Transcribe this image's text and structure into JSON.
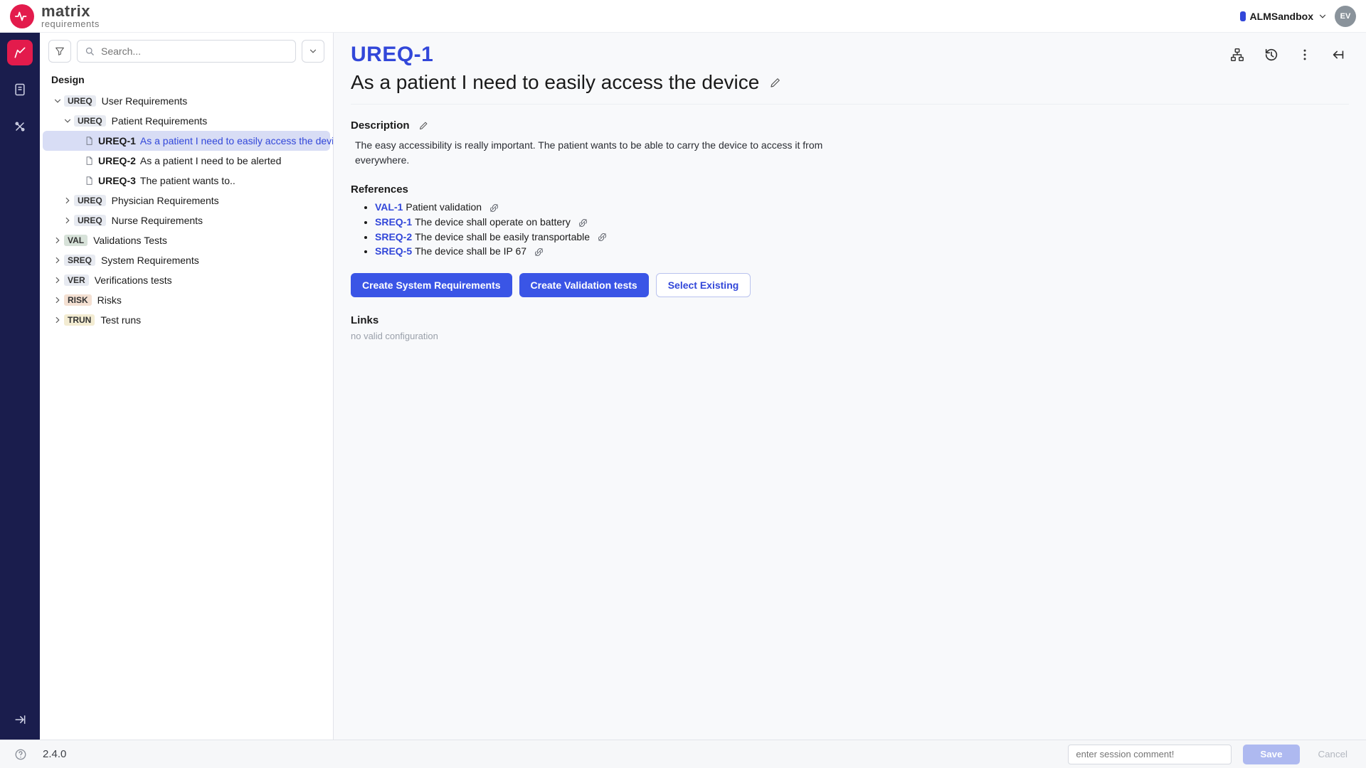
{
  "brand": {
    "line1": "matrix",
    "line2": "requirements"
  },
  "project": {
    "name": "ALMSandbox"
  },
  "avatar": "EV",
  "rail": {
    "items": [
      {
        "name": "design",
        "active": true
      },
      {
        "name": "docs",
        "active": false
      },
      {
        "name": "tools",
        "active": false
      }
    ]
  },
  "search": {
    "placeholder": "Search..."
  },
  "tree": {
    "section": "Design",
    "nodes": [
      {
        "type": "folder",
        "expanded": true,
        "depth": 0,
        "badge": "UREQ",
        "badgeClass": "b-ureq",
        "text": "User Requirements"
      },
      {
        "type": "folder",
        "expanded": true,
        "depth": 1,
        "badge": "UREQ",
        "badgeClass": "b-ureq",
        "text": "Patient Requirements"
      },
      {
        "type": "item",
        "depth": 2,
        "id": "UREQ-1",
        "text": "As a patient I need to easily access the device",
        "selected": true
      },
      {
        "type": "item",
        "depth": 2,
        "id": "UREQ-2",
        "text": "As a patient I need to be alerted"
      },
      {
        "type": "item",
        "depth": 2,
        "id": "UREQ-3",
        "text": "The patient wants to.."
      },
      {
        "type": "folder",
        "expanded": false,
        "depth": 1,
        "badge": "UREQ",
        "badgeClass": "b-ureq",
        "text": "Physician Requirements"
      },
      {
        "type": "folder",
        "expanded": false,
        "depth": 1,
        "badge": "UREQ",
        "badgeClass": "b-ureq",
        "text": "Nurse Requirements"
      },
      {
        "type": "folder",
        "expanded": false,
        "depth": 0,
        "badge": "VAL",
        "badgeClass": "b-val",
        "text": "Validations Tests"
      },
      {
        "type": "folder",
        "expanded": false,
        "depth": 0,
        "badge": "SREQ",
        "badgeClass": "b-sreq",
        "text": "System Requirements"
      },
      {
        "type": "folder",
        "expanded": false,
        "depth": 0,
        "badge": "VER",
        "badgeClass": "b-ver",
        "text": "Verifications tests"
      },
      {
        "type": "folder",
        "expanded": false,
        "depth": 0,
        "badge": "RISK",
        "badgeClass": "b-risk",
        "text": "Risks"
      },
      {
        "type": "folder",
        "expanded": false,
        "depth": 0,
        "badge": "TRUN",
        "badgeClass": "b-trun",
        "text": "Test runs"
      }
    ]
  },
  "item": {
    "code": "UREQ-1",
    "title": "As a patient I need to easily access the device",
    "description_heading": "Description",
    "description": "The easy accessibility is really important. The patient wants to be able to carry the device to access it from everywhere.",
    "references_heading": "References",
    "references": [
      {
        "id": "VAL-1",
        "text": "Patient validation"
      },
      {
        "id": "SREQ-1",
        "text": "The device shall operate on battery"
      },
      {
        "id": "SREQ-2",
        "text": "The device shall be easily transportable"
      },
      {
        "id": "SREQ-5",
        "text": "The device shall be IP 67"
      }
    ],
    "actions": {
      "create_sys": "Create System Requirements",
      "create_val": "Create Validation tests",
      "select_existing": "Select Existing"
    },
    "links_heading": "Links",
    "links_empty": "no valid configuration"
  },
  "footer": {
    "version": "2.4.0",
    "comment_placeholder": "enter session comment!",
    "save": "Save",
    "cancel": "Cancel"
  }
}
